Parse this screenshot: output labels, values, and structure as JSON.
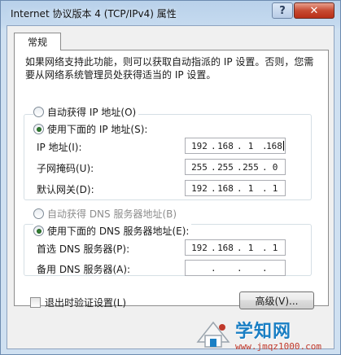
{
  "window": {
    "title": "Internet 协议版本 4 (TCP/IPv4) 属性",
    "help_label": "?",
    "close_label": "✕"
  },
  "tab": {
    "label": "常规"
  },
  "description": "如果网络支持此功能，则可以获取自动指派的 IP 设置。否则，您需要从网络系统管理员处获得适当的 IP 设置。",
  "ip_section": {
    "auto_label": "自动获得 IP 地址(O)",
    "manual_label": "使用下面的 IP 地址(S):",
    "selected": "manual",
    "fields": [
      {
        "label": "IP 地址(I):",
        "octets": [
          "192",
          "168",
          "1",
          "168"
        ]
      },
      {
        "label": "子网掩码(U):",
        "octets": [
          "255",
          "255",
          "255",
          "0"
        ]
      },
      {
        "label": "默认网关(D):",
        "octets": [
          "192",
          "168",
          "1",
          "1"
        ]
      }
    ]
  },
  "dns_section": {
    "auto_label": "自动获得 DNS 服务器地址(B)",
    "manual_label": "使用下面的 DNS 服务器地址(E):",
    "selected": "manual",
    "fields": [
      {
        "label": "首选 DNS 服务器(P):",
        "octets": [
          "192",
          "168",
          "1",
          "1"
        ]
      },
      {
        "label": "备用 DNS 服务器(A):",
        "octets": [
          "",
          "",
          "",
          ""
        ]
      }
    ]
  },
  "validate_checkbox": {
    "label": "退出时验证设置(L)",
    "checked": false
  },
  "advanced_button": {
    "label": "高级(V)..."
  },
  "watermark": {
    "main": "学知网",
    "sub": "www.jmqz1000.com"
  },
  "colors": {
    "radio_dot": "#2b7a2b",
    "watermark_blue": "#1a7fc4",
    "watermark_red": "#c0392b"
  }
}
